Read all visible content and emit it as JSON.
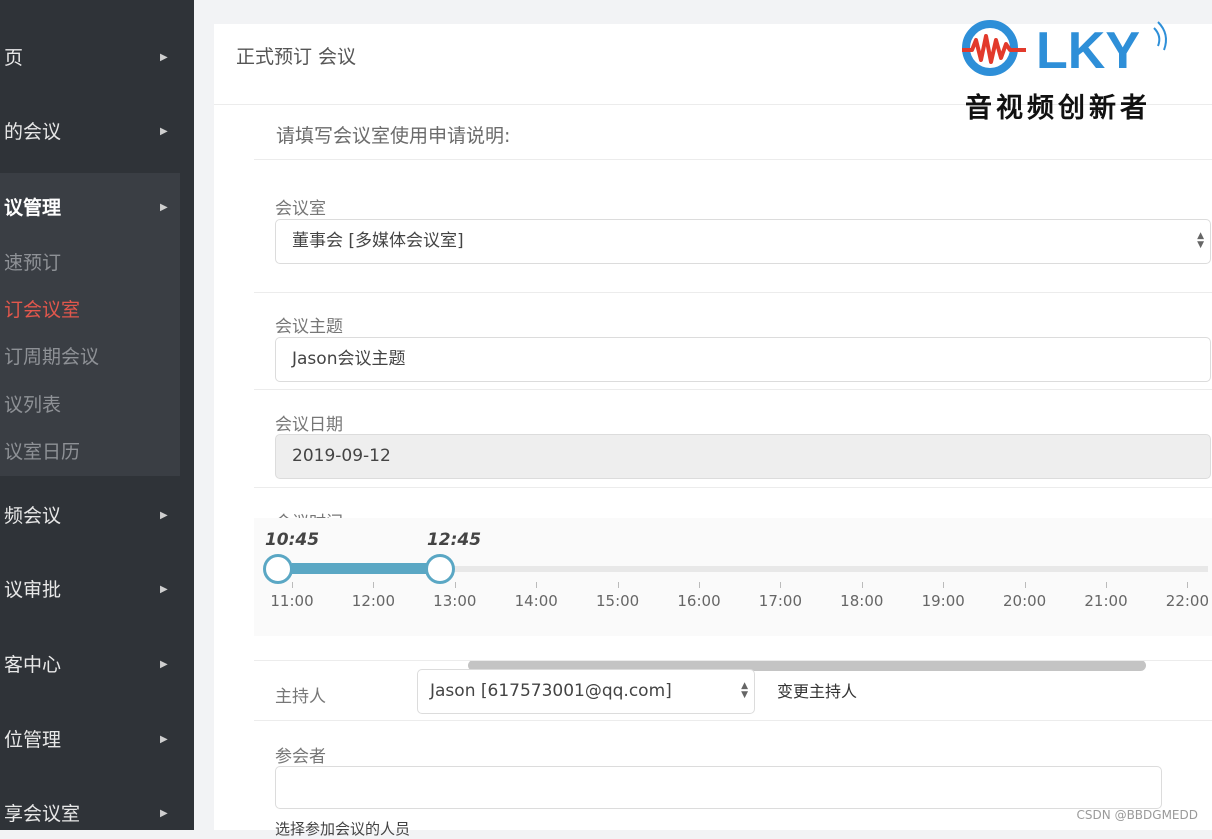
{
  "sidebar": {
    "items": [
      {
        "label": "页"
      },
      {
        "label": "的会议"
      },
      {
        "label": "议管理"
      },
      {
        "label": "频会议"
      },
      {
        "label": "议审批"
      },
      {
        "label": "客中心"
      },
      {
        "label": "位管理"
      },
      {
        "label": "享会议室"
      }
    ],
    "sub_items": [
      {
        "label": "速预订"
      },
      {
        "label": "订会议室"
      },
      {
        "label": "订周期会议"
      },
      {
        "label": "议列表"
      },
      {
        "label": "议室日历"
      }
    ],
    "arrow_glyph": "▶",
    "active_color": "#e2574c"
  },
  "panel": {
    "title": "正式预订 会议",
    "intro": "请填写会议室使用申请说明:"
  },
  "form": {
    "room_label": "会议室",
    "room_value": "董事会  [多媒体会议室]",
    "subject_label": "会议主题",
    "subject_value": "Jason会议主题",
    "date_label": "会议日期",
    "date_value": "2019-09-12",
    "time_label": "会议时间",
    "time_start": "10:45",
    "time_end": "12:45",
    "time_ticks": [
      "11:00",
      "12:00",
      "13:00",
      "14:00",
      "15:00",
      "16:00",
      "17:00",
      "18:00",
      "19:00",
      "20:00",
      "21:00",
      "22:00"
    ],
    "host_label": "主持人",
    "host_value": "Jason [617573001@qq.com]",
    "change_host": "变更主持人",
    "attendees_label": "参会者",
    "attendees_value": "",
    "attendees_hint": "选择参加会议的人员"
  },
  "logo": {
    "text": "LKY",
    "subtitle": "音视频创新者",
    "color": "#2e8fd8",
    "accent": "#e23a2c"
  },
  "watermark": "CSDN @BBDGMEDD"
}
